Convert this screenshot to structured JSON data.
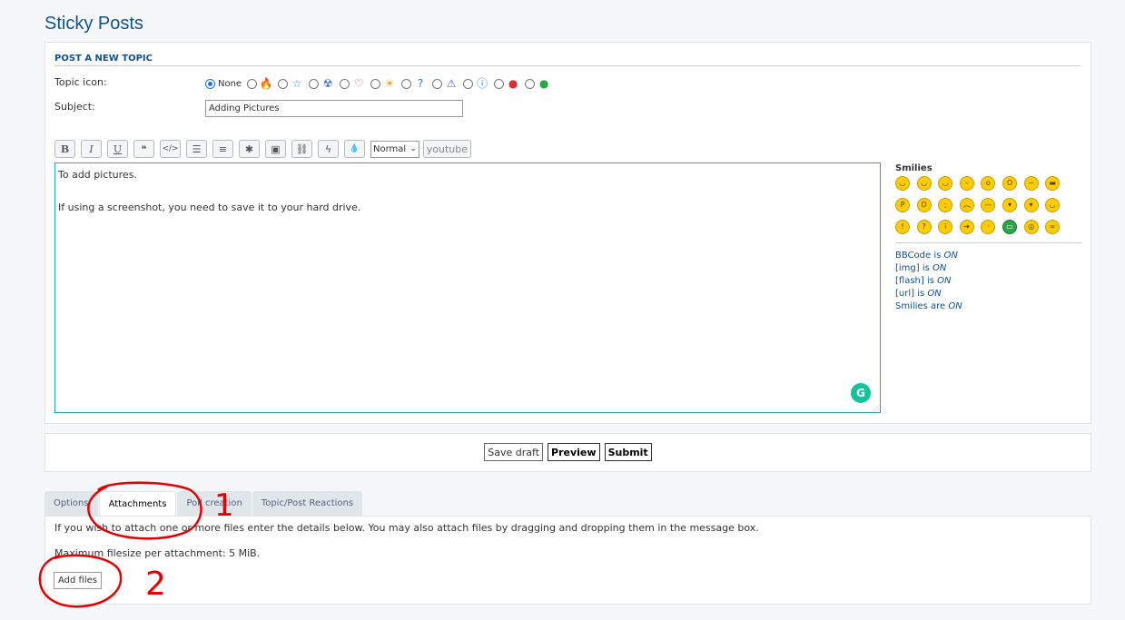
{
  "page": {
    "title": "Sticky Posts"
  },
  "post_form": {
    "section_title": "POST A NEW TOPIC",
    "topic_icon_label": "Topic icon:",
    "topic_icon_none": "None",
    "topic_icons": [
      "fire-icon",
      "star-icon",
      "radioactive-icon",
      "heart-icon",
      "sun-icon",
      "question-icon",
      "warning-icon",
      "info-icon",
      "red-face-icon",
      "green-face-icon"
    ],
    "subject_label": "Subject:",
    "subject_value": "Adding Pictures",
    "toolbar": {
      "bold": "B",
      "italic": "I",
      "underline": "U",
      "quote": "❝",
      "code": "</>",
      "list": "☰",
      "list_numbered": "≡",
      "list_item": "✱",
      "image": "▣",
      "url": "⛓",
      "flash": "ϟ",
      "color": "💧",
      "font_size": "Normal",
      "youtube": "youtube"
    },
    "message_lines": [
      "To add pictures.",
      "",
      "If using a screenshot, you need to save it to your hard drive."
    ]
  },
  "sidebar": {
    "smilies_title": "Smilies",
    "smilies": [
      "😄",
      "😃",
      "😉",
      "😐",
      "😮",
      "😳",
      "😕",
      "😎",
      "😛",
      "😆",
      "😜",
      "😟",
      "😑",
      "😈",
      "😾",
      "🙂",
      "❗",
      "❓",
      "💡",
      "➡",
      "🙁",
      "🟢",
      "🤓",
      "🤪"
    ],
    "status": [
      {
        "label": "BBCode is ",
        "value": "ON"
      },
      {
        "label": "[img] is ",
        "value": "ON"
      },
      {
        "label": "[flash] is ",
        "value": "ON"
      },
      {
        "label": "[url] is ",
        "value": "ON"
      },
      {
        "label": "Smilies are ",
        "value": "ON"
      }
    ]
  },
  "submit_bar": {
    "save_draft": "Save draft",
    "preview": "Preview",
    "submit": "Submit"
  },
  "tabs": [
    "Options",
    "Attachments",
    "Poll creation",
    "Topic/Post Reactions"
  ],
  "active_tab": "Attachments",
  "attachments": {
    "instructions": "If you wish to attach one or more files enter the details below. You may also attach files by dragging and dropping them in the message box.",
    "max_size": "Maximum filesize per attachment: 5 MiB.",
    "add_files": "Add files"
  },
  "annotations": {
    "label_1": "1",
    "label_2": "2",
    "color": "#e00000"
  }
}
